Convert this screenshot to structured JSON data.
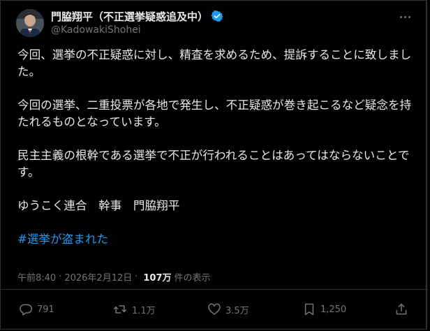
{
  "author": {
    "display_name": "門脇翔平（不正選挙疑惑追及中）",
    "handle": "@KadowakiShohei",
    "verified": true
  },
  "post": {
    "paragraphs": [
      "今回、選挙の不正疑惑に対し、精査を求めるため、提訴することに致しました。",
      "今回の選挙、二重投票が各地で発生し、不正疑惑が巻き起こるなど疑念を持たれるものとなっています。",
      "民主主義の根幹である選挙で不正が行われることはあってはならないことです。",
      "ゆうこく連合　幹事　門脇翔平"
    ],
    "hashtag": "#選挙が盗まれた"
  },
  "meta": {
    "time": "午前8:40",
    "separator": "·",
    "date": "2026年2月12日",
    "views_count": "107万",
    "views_label": "件の表示"
  },
  "actions": {
    "replies": "791",
    "reposts": "1.1万",
    "likes": "3.5万",
    "bookmarks": "1,250"
  },
  "colors": {
    "background": "#000000",
    "text": "#e7e9ea",
    "muted": "#71767b",
    "accent": "#1d9bf0",
    "border": "#2f3336"
  },
  "icons": {
    "verified": "verified-badge-icon",
    "more": "more-icon",
    "reply": "reply-icon",
    "repost": "repost-icon",
    "like": "like-icon",
    "bookmark": "bookmark-icon",
    "share": "share-icon"
  }
}
